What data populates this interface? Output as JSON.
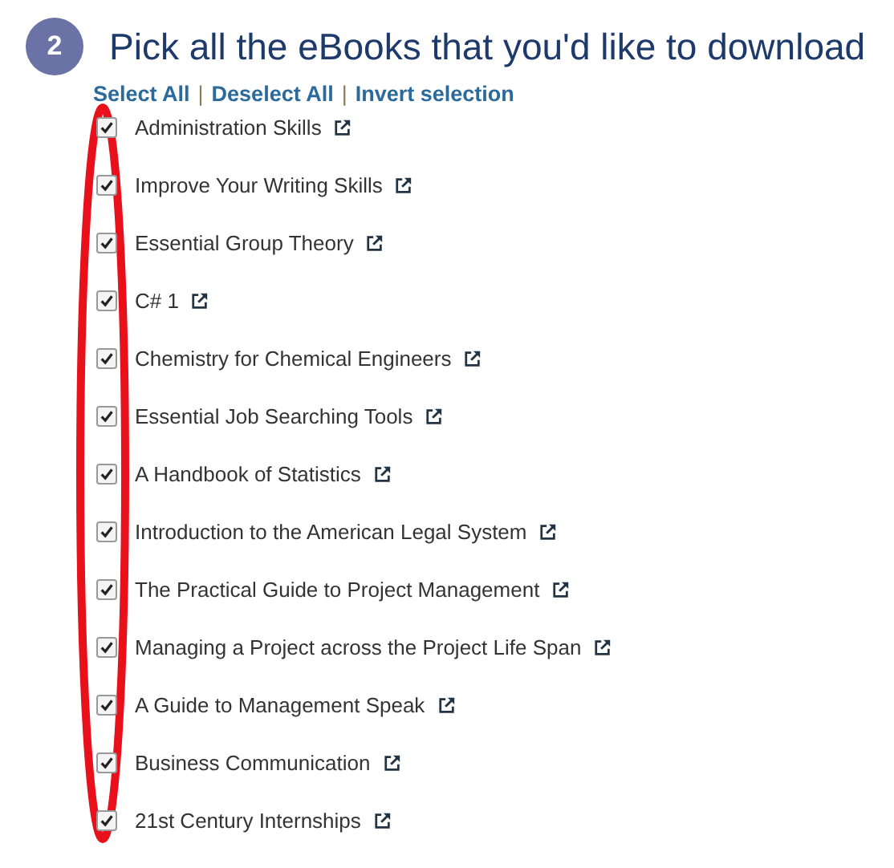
{
  "step": {
    "number": "2",
    "title": "Pick all the eBooks that you'd like to download"
  },
  "actions": [
    "Select All",
    "Deselect All",
    "Invert selection"
  ],
  "separator": "|",
  "books": [
    {
      "title": "Administration Skills",
      "checked": true
    },
    {
      "title": "Improve Your Writing Skills",
      "checked": true
    },
    {
      "title": "Essential Group Theory",
      "checked": true
    },
    {
      "title": "C# 1",
      "checked": true
    },
    {
      "title": "Chemistry for Chemical Engineers",
      "checked": true
    },
    {
      "title": "Essential Job Searching Tools",
      "checked": true
    },
    {
      "title": "A Handbook of Statistics",
      "checked": true
    },
    {
      "title": "Introduction to the American Legal System",
      "checked": true
    },
    {
      "title": "The Practical Guide to Project Management",
      "checked": true
    },
    {
      "title": "Managing a Project across the Project Life Span",
      "checked": true
    },
    {
      "title": "A Guide to Management Speak",
      "checked": true
    },
    {
      "title": "Business Communication",
      "checked": true
    },
    {
      "title": "21st Century Internships",
      "checked": true
    }
  ]
}
